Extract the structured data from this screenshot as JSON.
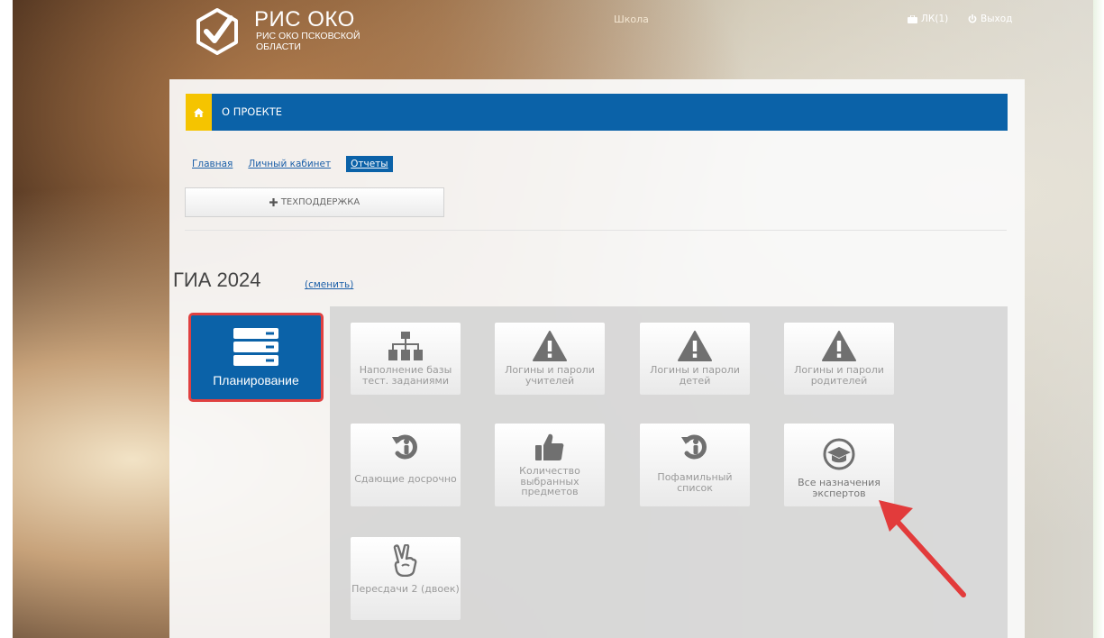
{
  "brand": {
    "title": "РИС ОКО",
    "subtitle": "РИС ОКО ПСКОВСКОЙ ОБЛАСТИ"
  },
  "topbar": {
    "school": "Школа",
    "lk_label": "ЛК(1)",
    "exit_label": "Выход"
  },
  "nav": {
    "about_label": "О ПРОЕКТЕ"
  },
  "breadcrumbs": {
    "home": "Главная",
    "cabinet": "Личный кабинет",
    "reports": "Отчеты"
  },
  "support": {
    "label": "ТЕХПОДДЕРЖКА"
  },
  "section": {
    "title": "ГИА 2024",
    "change_label": "(сменить)"
  },
  "planning": {
    "label": "Планирование"
  },
  "tiles": [
    {
      "label": "Наполнение базы тест. заданиями",
      "icon": "sitemap-icon"
    },
    {
      "label": "Логины и пароли учителей",
      "icon": "warning-icon"
    },
    {
      "label": "Логины и пароли детей",
      "icon": "warning-icon"
    },
    {
      "label": "Логины и пароли родителей",
      "icon": "warning-icon"
    },
    {
      "label": "Сдающие досрочно",
      "icon": "undo-person-icon"
    },
    {
      "label": "Количество выбранных предметов",
      "icon": "thumbs-up-icon"
    },
    {
      "label": "Пофамильный список",
      "icon": "undo-person-icon"
    },
    {
      "label": "Все назначения экспертов",
      "icon": "graduation-cap-icon"
    },
    {
      "label": "Пересдачи 2 (двоек)",
      "icon": "victory-hand-icon"
    }
  ],
  "colors": {
    "primary": "#0b62a8",
    "home_accent": "#f5c400",
    "highlight_border": "#e04040",
    "arrow": "#e23b3b"
  }
}
